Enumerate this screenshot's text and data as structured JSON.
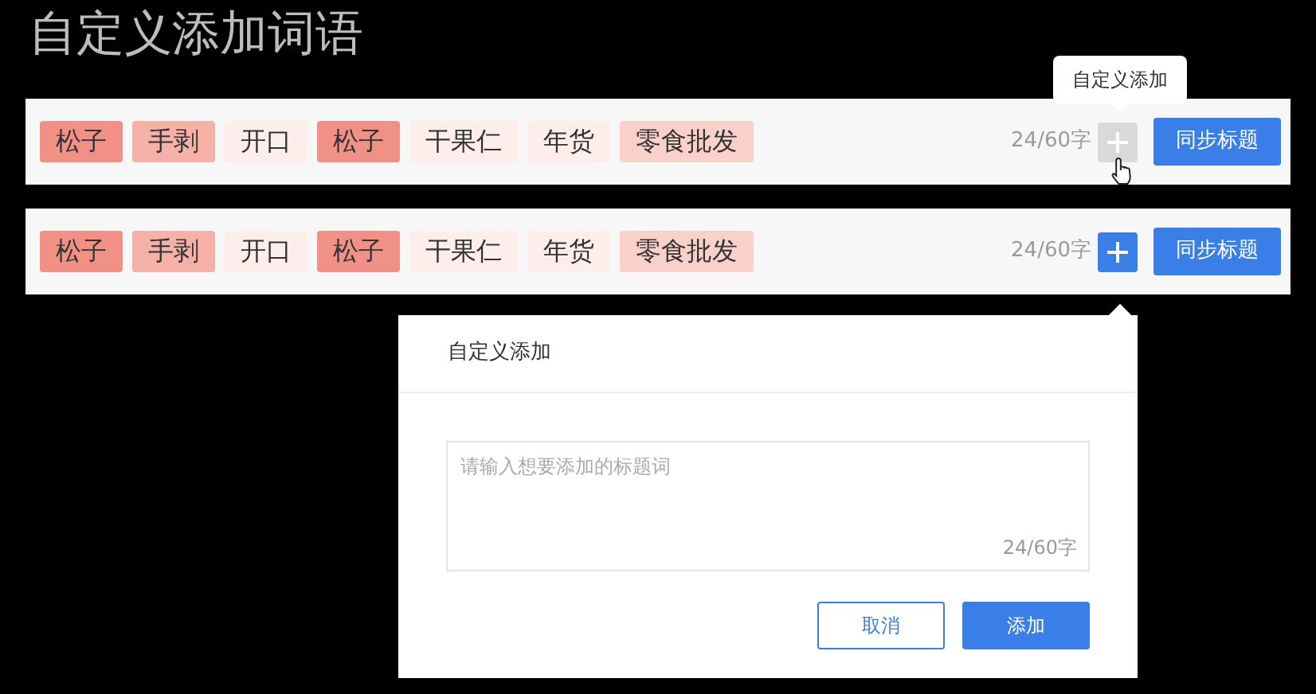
{
  "title": "自定义添加词语",
  "bars": [
    {
      "tags": [
        {
          "label": "松子",
          "color": "#f19085"
        },
        {
          "label": "手剥",
          "color": "#f5b0a8"
        },
        {
          "label": "开口",
          "color": "#fdeeec"
        },
        {
          "label": "松子",
          "color": "#f19085"
        },
        {
          "label": "干果仁",
          "color": "#fdeeec"
        },
        {
          "label": "年货",
          "color": "#fdeeec"
        },
        {
          "label": "零食批发",
          "color": "#f9d0ca"
        }
      ],
      "counter": "24/60字",
      "add_button": {
        "hovered": true,
        "tooltip": "自定义添加"
      },
      "sync_button": "同步标题"
    },
    {
      "tags": [
        {
          "label": "松子",
          "color": "#f19085"
        },
        {
          "label": "手剥",
          "color": "#f5b0a8"
        },
        {
          "label": "开口",
          "color": "#fdeeec"
        },
        {
          "label": "松子",
          "color": "#f19085"
        },
        {
          "label": "干果仁",
          "color": "#fdeeec"
        },
        {
          "label": "年货",
          "color": "#fdeeec"
        },
        {
          "label": "零食批发",
          "color": "#f9d0ca"
        }
      ],
      "counter": "24/60字",
      "add_button": {
        "hovered": false
      },
      "sync_button": "同步标题"
    }
  ],
  "popover": {
    "title": "自定义添加",
    "textarea": {
      "placeholder": "请输入想要添加的标题词",
      "counter": "24/60字"
    },
    "buttons": [
      {
        "label": "取消",
        "kind": "secondary"
      },
      {
        "label": "添加",
        "kind": "primary"
      }
    ]
  }
}
